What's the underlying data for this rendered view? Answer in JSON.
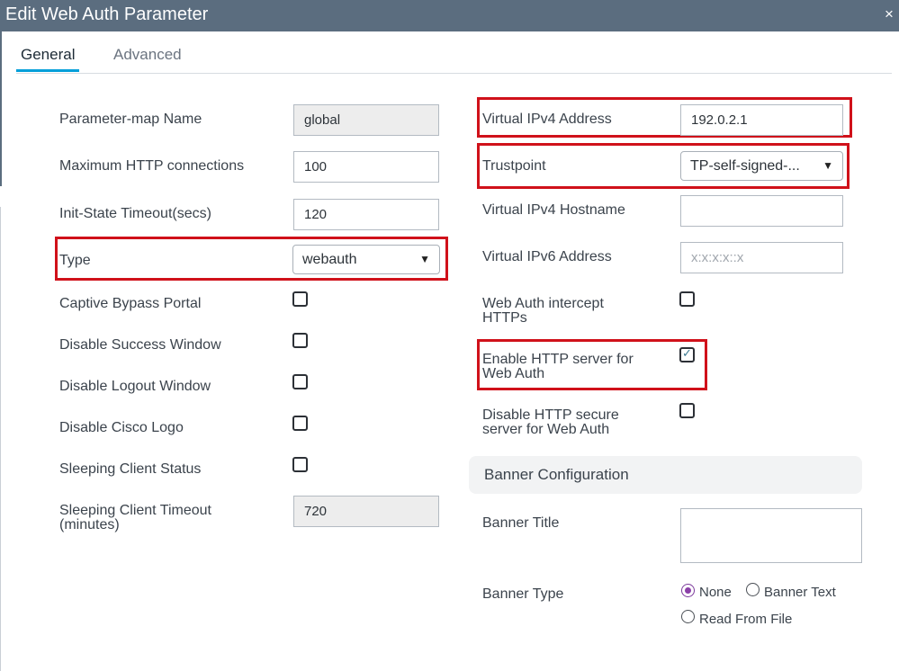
{
  "dialog": {
    "title": "Edit Web Auth Parameter",
    "close_glyph": "×"
  },
  "tabs": [
    {
      "label": "General",
      "active": true
    },
    {
      "label": "Advanced",
      "active": false
    }
  ],
  "left": {
    "parameter_map_name": {
      "label": "Parameter-map Name",
      "value": "global"
    },
    "max_http_connections": {
      "label": "Maximum HTTP connections",
      "value": "100"
    },
    "init_state_timeout": {
      "label": "Init-State Timeout(secs)",
      "value": "120"
    },
    "type": {
      "label": "Type",
      "value": "webauth"
    },
    "captive_bypass_portal": {
      "label": "Captive Bypass Portal",
      "checked": false
    },
    "disable_success_window": {
      "label": "Disable Success Window",
      "checked": false
    },
    "disable_logout_window": {
      "label": "Disable Logout Window",
      "checked": false
    },
    "disable_cisco_logo": {
      "label": "Disable Cisco Logo",
      "checked": false
    },
    "sleeping_client_status": {
      "label": "Sleeping Client Status",
      "checked": false
    },
    "sleeping_client_timeout": {
      "label_line1": "Sleeping Client Timeout",
      "label_line2": "(minutes)",
      "value": "720"
    }
  },
  "right": {
    "virtual_ipv4_address": {
      "label": "Virtual IPv4 Address",
      "value": "192.0.2.1"
    },
    "trustpoint": {
      "label": "Trustpoint",
      "value": "TP-self-signed-..."
    },
    "virtual_ipv4_hostname": {
      "label": "Virtual IPv4 Hostname",
      "value": ""
    },
    "virtual_ipv6_address": {
      "label": "Virtual IPv6 Address",
      "placeholder": "x:x:x:x::x"
    },
    "web_auth_intercept_https": {
      "label_line1": "Web Auth intercept",
      "label_line2": "HTTPs",
      "checked": false
    },
    "enable_http_server": {
      "label_line1": "Enable HTTP server for",
      "label_line2": "Web Auth",
      "checked": true
    },
    "disable_http_secure_server": {
      "label_line1": "Disable HTTP secure",
      "label_line2": "server for Web Auth",
      "checked": false
    }
  },
  "banner": {
    "section_title": "Banner Configuration",
    "title_label": "Banner Title",
    "type_label": "Banner Type",
    "options": [
      {
        "label": "None",
        "selected": true
      },
      {
        "label": "Banner Text",
        "selected": false
      },
      {
        "label": "Read From File",
        "selected": false
      }
    ]
  },
  "icons": {
    "dropdown": "▼",
    "check": "✓"
  },
  "colors": {
    "titlebar": "#5b6d7f",
    "highlight_box": "#d0111a",
    "tab_accent": "#049fd9",
    "radio_selected": "#8b3fa8"
  }
}
